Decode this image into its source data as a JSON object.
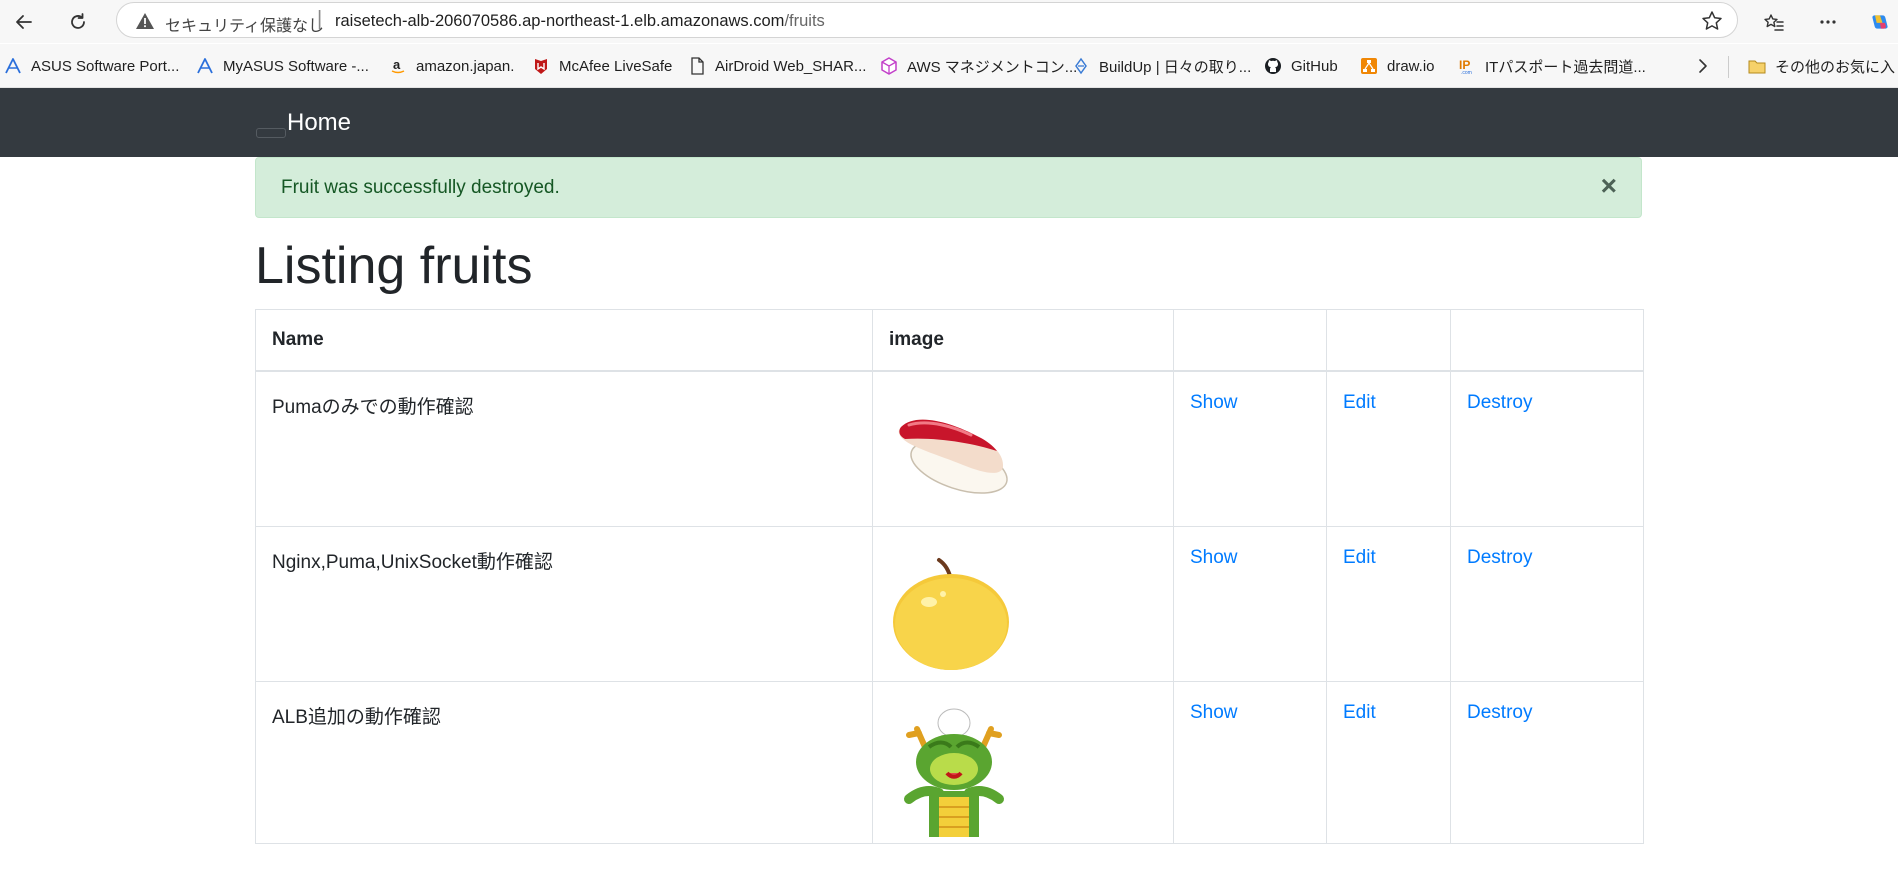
{
  "browser": {
    "security_label": "セキュリティ保護なし",
    "url_host": "raisetech-alb-206070586.ap-northeast-1.elb.amazonaws.com",
    "url_path": "/fruits"
  },
  "bookmarks": [
    {
      "label": "ASUS Software Port...",
      "icon": "asus-icon"
    },
    {
      "label": "MyASUS Software -...",
      "icon": "asus-icon"
    },
    {
      "label": "amazon.japan.",
      "icon": "amazon-icon"
    },
    {
      "label": "McAfee LiveSafe",
      "icon": "mcafee-icon"
    },
    {
      "label": "AirDroid Web_SHAR...",
      "icon": "document-icon"
    },
    {
      "label": "AWS マネジメントコン...",
      "icon": "aws-icon"
    },
    {
      "label": "BuildUp | 日々の取り...",
      "icon": "buildup-icon"
    },
    {
      "label": "GitHub",
      "icon": "github-icon"
    },
    {
      "label": "draw.io",
      "icon": "drawio-icon"
    },
    {
      "label": "ITパスポート過去問道...",
      "icon": "ip-icon"
    },
    {
      "label": "その他のお気に入り",
      "icon": "folder-icon"
    }
  ],
  "navbar": {
    "brand": "Home"
  },
  "alert": {
    "message": "Fruit was successfully destroyed.",
    "close": "×"
  },
  "page": {
    "title": "Listing fruits"
  },
  "table": {
    "headers": [
      "Name",
      "image",
      "",
      "",
      ""
    ],
    "rows": [
      {
        "name": "Pumaのみでの動作確認",
        "image": "sushi-image",
        "show": "Show",
        "edit": "Edit",
        "destroy": "Destroy"
      },
      {
        "name": "Nginx,Puma,UnixSocket動作確認",
        "image": "pear-image",
        "show": "Show",
        "edit": "Edit",
        "destroy": "Destroy"
      },
      {
        "name": "ALB追加の動作確認",
        "image": "dragon-image",
        "show": "Show",
        "edit": "Edit",
        "destroy": "Destroy"
      }
    ]
  },
  "colors": {
    "navbar": "#343a40",
    "alert_bg": "#d4edda",
    "alert_text": "#155724",
    "link": "#007bff"
  }
}
